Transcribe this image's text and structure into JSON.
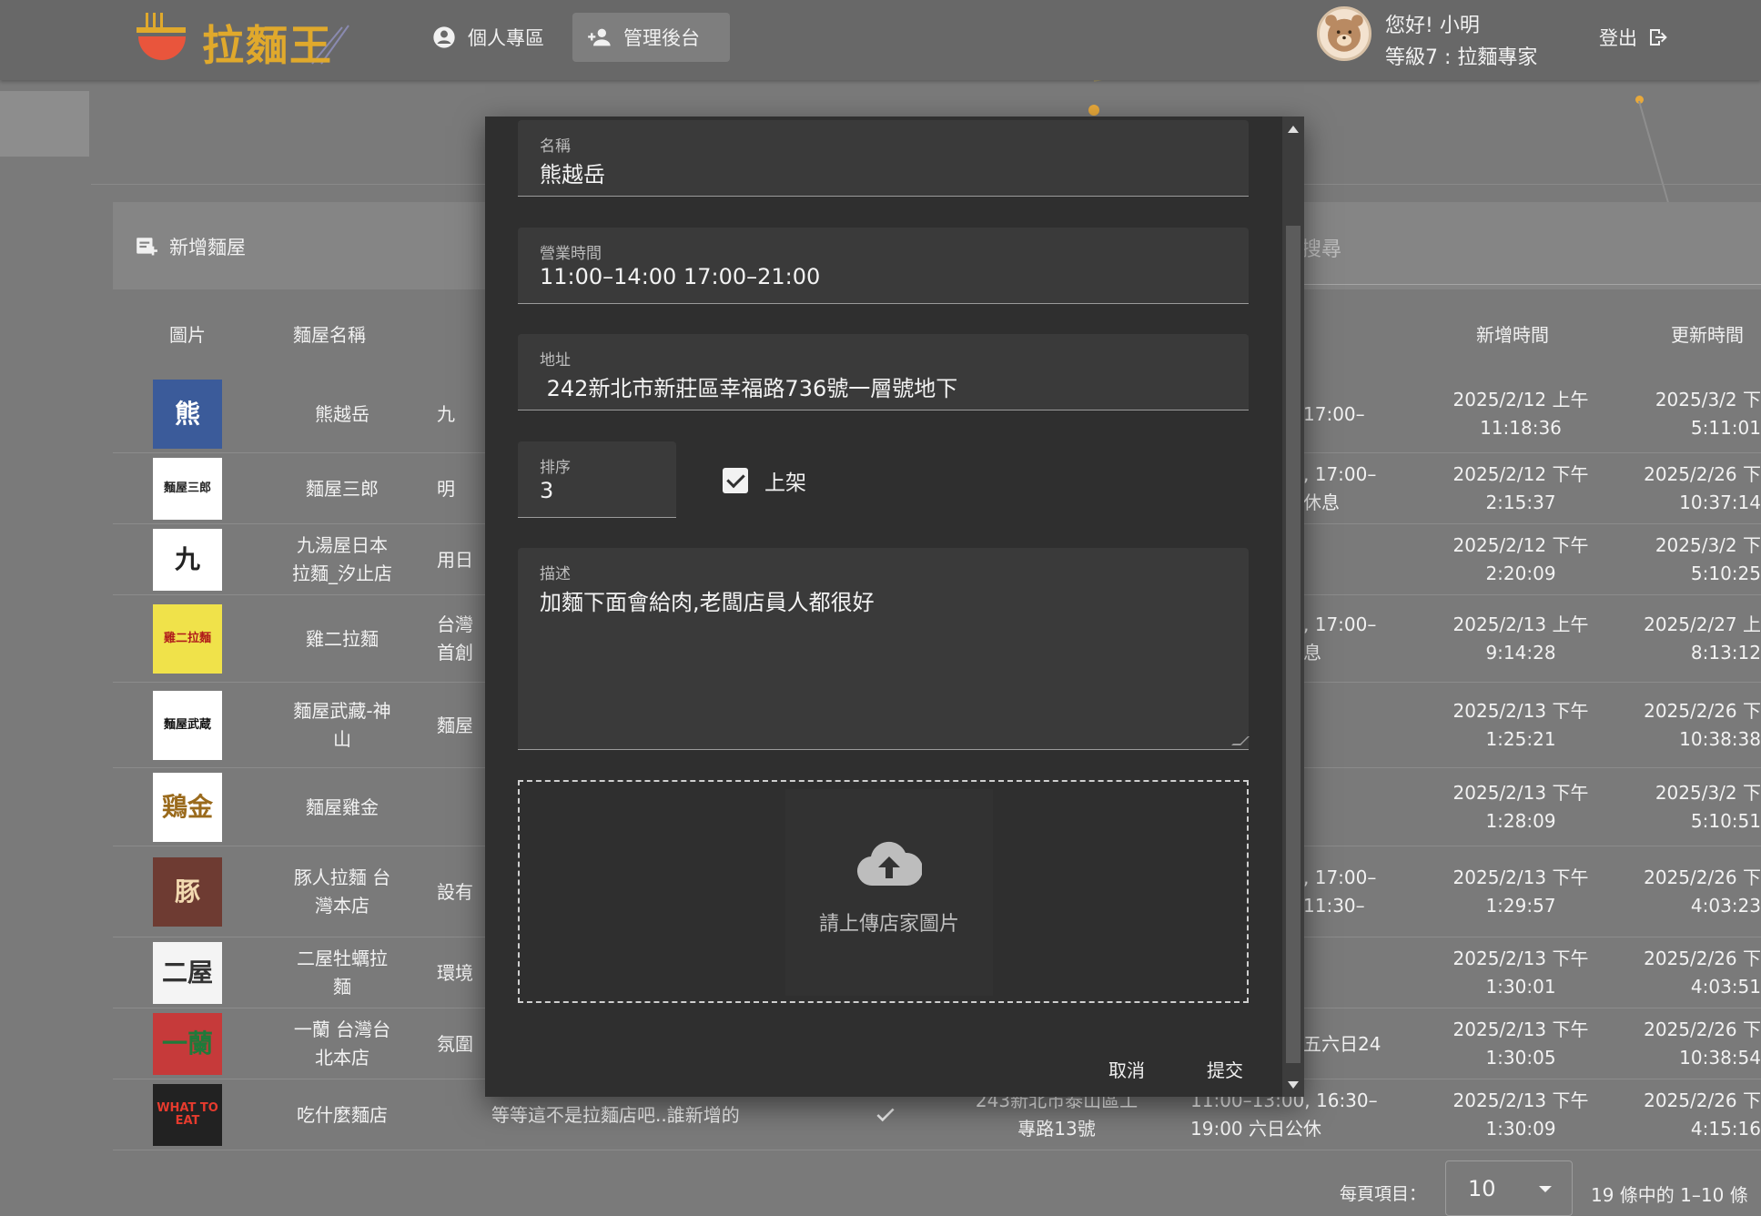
{
  "app": {
    "logo_text": "拉麵王"
  },
  "nav": {
    "personal": "個人專區",
    "admin": "管理後台"
  },
  "user": {
    "greeting": "您好! 小明",
    "level": "等級7 : 拉麵專家",
    "logout": "登出"
  },
  "toolbar": {
    "add_label": "新增麵屋",
    "search_placeholder": "搜尋"
  },
  "table": {
    "headers": {
      "image": "圖片",
      "name": "麵屋名稱",
      "created": "新增時間",
      "updated": "更新時間"
    },
    "rows": [
      {
        "name": "熊越岳",
        "desc": "九",
        "hours": "17:00–",
        "created": "2025/2/12 上午\n11:18:36",
        "updated": "2025/3/2 下\n5:11:01",
        "thumb_text": "熊",
        "thumb_bg": "#3b5b9a",
        "thumb_fg": "#ffffff"
      },
      {
        "name": "麵屋三郎",
        "desc": "明",
        "hours": ", 17:00–\n休息",
        "created": "2025/2/12 下午\n2:15:37",
        "updated": "2025/2/26 下\n10:37:14",
        "thumb_text": "麵屋三郎",
        "thumb_bg": "#ffffff",
        "thumb_fg": "#222222"
      },
      {
        "name": "九湯屋日本\n拉麵_汐止店",
        "desc": "用日",
        "hours": "",
        "created": "2025/2/12 下午\n2:20:09",
        "updated": "2025/3/2 下\n5:10:25",
        "thumb_text": "九",
        "thumb_bg": "#ffffff",
        "thumb_fg": "#222222"
      },
      {
        "name": "雞二拉麵",
        "desc": "台灣\n首創",
        "hours": ", 17:00–\n息",
        "created": "2025/2/13 上午\n9:14:28",
        "updated": "2025/2/27 上\n8:13:12",
        "thumb_text": "雞二拉麵",
        "thumb_bg": "#f0e24a",
        "thumb_fg": "#b01a1a"
      },
      {
        "name": "麵屋武藏-神\n山",
        "desc": "麵屋",
        "hours": "",
        "created": "2025/2/13 下午\n1:25:21",
        "updated": "2025/2/26 下\n10:38:38",
        "thumb_text": "麵屋武蔵",
        "thumb_bg": "#ffffff",
        "thumb_fg": "#111111"
      },
      {
        "name": "麵屋雞金",
        "desc": "",
        "hours": "",
        "created": "2025/2/13 下午\n1:28:09",
        "updated": "2025/3/2 下\n5:10:51",
        "thumb_text": "鶏金",
        "thumb_bg": "#ffffff",
        "thumb_fg": "#9a6a1c"
      },
      {
        "name": "豚人拉麵 台\n灣本店",
        "desc": "設有",
        "hours": ", 17:00–\n11:30–",
        "created": "2025/2/13 下午\n1:29:57",
        "updated": "2025/2/26 下\n4:03:23",
        "thumb_text": "豚",
        "thumb_bg": "#6e3b32",
        "thumb_fg": "#f2d9b0"
      },
      {
        "name": "二屋牡蠣拉\n麵",
        "desc": "環境",
        "hours": "",
        "created": "2025/2/13 下午\n1:30:01",
        "updated": "2025/2/26 下\n4:03:51",
        "thumb_text": "二屋",
        "thumb_bg": "#f4f4f4",
        "thumb_fg": "#333333"
      },
      {
        "name": "一蘭 台灣台\n北本店",
        "desc": "氛圍",
        "hours": "五六日24",
        "created": "2025/2/13 下午\n1:30:05",
        "updated": "2025/2/26 下\n10:38:54",
        "thumb_text": "一蘭",
        "thumb_bg": "#c63a3a",
        "thumb_fg": "#1f7a3a"
      },
      {
        "name": "吃什麼麵店",
        "desc": "等等這不是拉麵店吧..誰新增的",
        "hours": "11:00–13:00, 16:30–\n19:00 六日公休",
        "created": "2025/2/13 下午\n1:30:09",
        "updated": "2025/2/26 下\n4:15:16",
        "thumb_text": "WHAT TO EAT",
        "thumb_bg": "#222222",
        "thumb_fg": "#e63b2e",
        "address": "243新北市泰山區工\n專路13號"
      }
    ]
  },
  "pagination": {
    "per_page_label": "每頁項目：",
    "per_page_value": "10",
    "range": "19 條中的 1–10 條"
  },
  "dialog": {
    "name_label": "名稱",
    "name_value": "熊越岳",
    "hours_label": "營業時間",
    "hours_value": "11:00–14:00 17:00–21:00",
    "address_label": "地址",
    "address_value": " 242新北市新莊區幸福路736號一層號地下",
    "order_label": "排序",
    "order_value": "3",
    "publish_label": "上架",
    "publish_checked": true,
    "desc_label": "描述",
    "desc_value": "加麵下面會給肉,老闆店員人都很好",
    "upload_text": "請上傳店家圖片",
    "cancel": "取消",
    "submit": "提交"
  },
  "colors": {
    "accent": "#e0a92c",
    "dialog_bg": "#2f2f2f",
    "field_bg": "#3a3a3a",
    "overlay": "#7a7a7a"
  }
}
